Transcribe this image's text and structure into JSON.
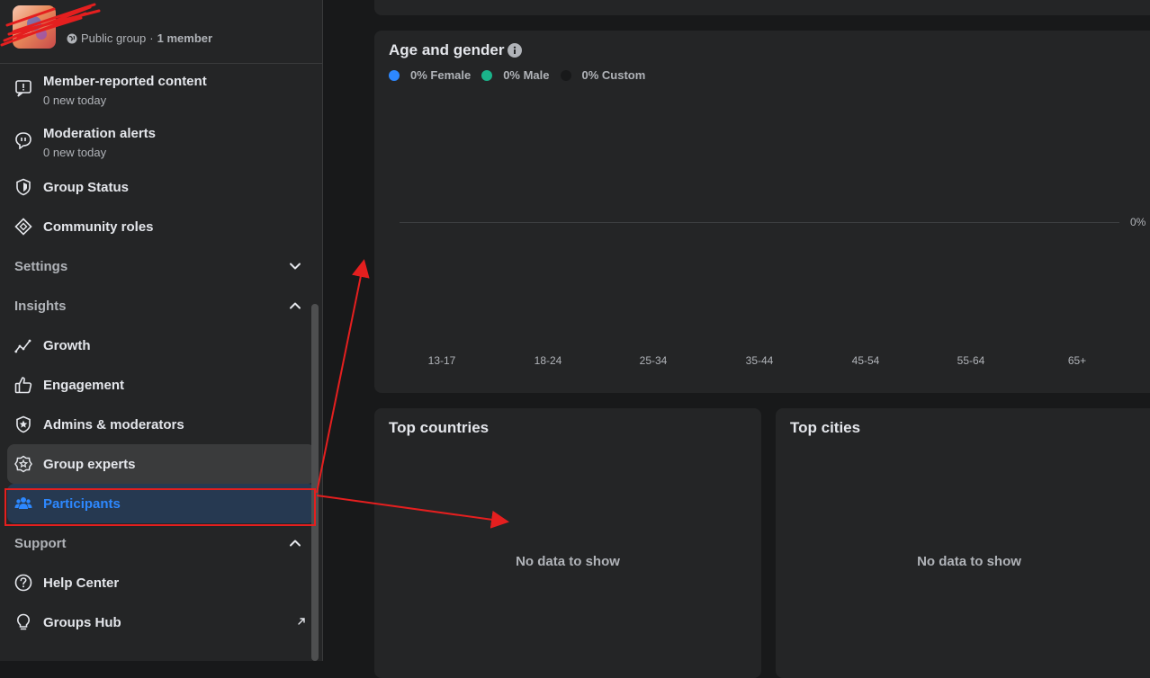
{
  "sidebar": {
    "group": {
      "privacy": "Public group",
      "separator": "·",
      "members": "1 member"
    },
    "items": [
      {
        "id": "member-reported",
        "label": "Member-reported content",
        "sub": "0 new today",
        "icon": "report-icon"
      },
      {
        "id": "moderation-alerts",
        "label": "Moderation alerts",
        "sub": "0 new today",
        "icon": "alert-bubble-icon"
      },
      {
        "id": "group-status",
        "label": "Group Status",
        "icon": "shield-icon"
      },
      {
        "id": "community-roles",
        "label": "Community roles",
        "icon": "diamond-icon"
      }
    ],
    "sections": {
      "settings": {
        "label": "Settings",
        "state": "collapsed"
      },
      "insights": {
        "label": "Insights",
        "state": "expanded"
      },
      "support": {
        "label": "Support",
        "state": "expanded"
      }
    },
    "insights_items": [
      {
        "id": "growth",
        "label": "Growth",
        "icon": "growth-chart-icon"
      },
      {
        "id": "engagement",
        "label": "Engagement",
        "icon": "thumbs-up-icon"
      },
      {
        "id": "admins",
        "label": "Admins & moderators",
        "icon": "star-badge-icon"
      },
      {
        "id": "experts",
        "label": "Group experts",
        "icon": "expert-badge-icon"
      },
      {
        "id": "participants",
        "label": "Participants",
        "icon": "people-icon"
      }
    ],
    "support_items": [
      {
        "id": "help-center",
        "label": "Help Center",
        "icon": "question-icon"
      },
      {
        "id": "groups-hub",
        "label": "Groups Hub",
        "icon": "lightbulb-icon"
      }
    ]
  },
  "main": {
    "age_gender": {
      "title": "Age and gender",
      "legend": [
        {
          "label": "0% Female",
          "color": "#2d88ff"
        },
        {
          "label": "0% Male",
          "color": "#1ab38a"
        },
        {
          "label": "0% Custom",
          "color": "#18191a"
        }
      ],
      "y_label": "0%",
      "age_groups": [
        "13-17",
        "18-24",
        "25-34",
        "35-44",
        "45-54",
        "55-64",
        "65+"
      ]
    },
    "top_countries": {
      "title": "Top countries",
      "empty": "No data to show"
    },
    "top_cities": {
      "title": "Top cities",
      "empty": "No data to show"
    }
  },
  "colors": {
    "accent": "#2d88ff",
    "annotation": "#e41f1f"
  }
}
